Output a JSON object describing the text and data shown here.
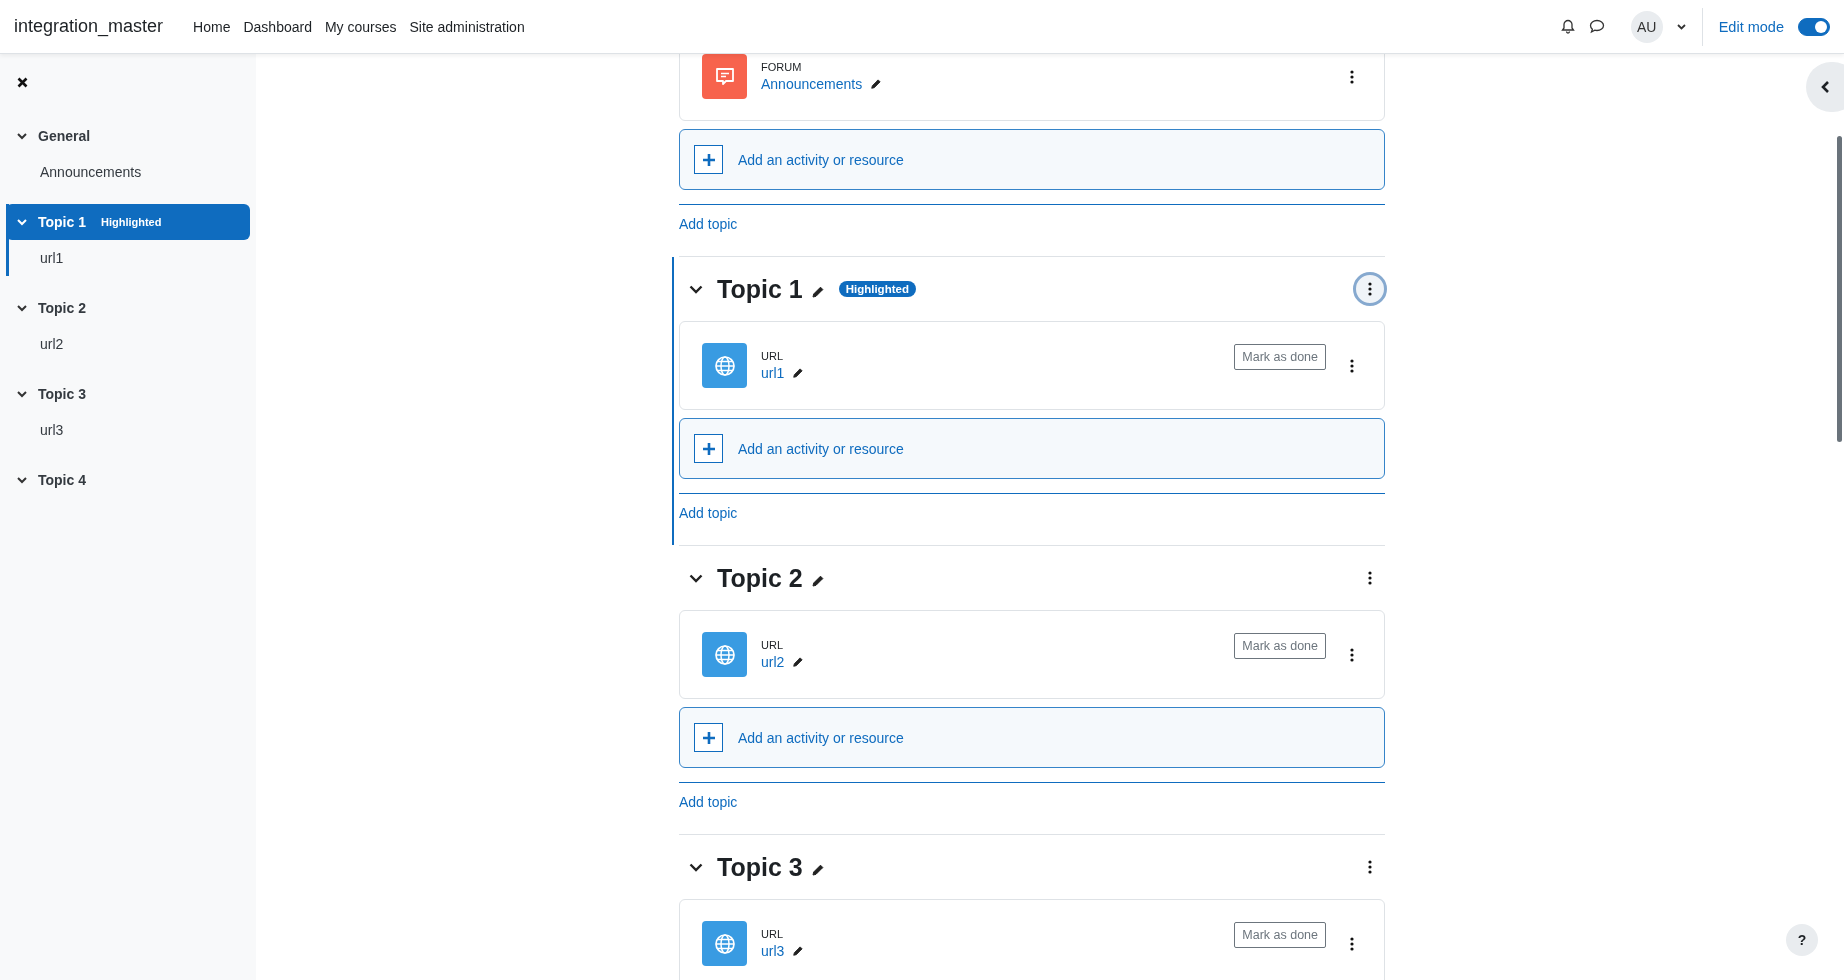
{
  "header": {
    "site_name": "integration_master",
    "nav": [
      {
        "label": "Home"
      },
      {
        "label": "Dashboard"
      },
      {
        "label": "My courses"
      },
      {
        "label": "Site administration"
      }
    ],
    "user_initials": "AU",
    "edit_mode": {
      "label": "Edit mode",
      "on": true
    }
  },
  "course_index": {
    "items": [
      {
        "title": "General",
        "selected": false,
        "children": [
          {
            "title": "Announcements"
          }
        ]
      },
      {
        "title": "Topic 1",
        "badge": "Highlighted",
        "selected": true,
        "children": [
          {
            "title": "url1"
          }
        ]
      },
      {
        "title": "Topic 2",
        "selected": false,
        "children": [
          {
            "title": "url2"
          }
        ]
      },
      {
        "title": "Topic 3",
        "selected": false,
        "children": [
          {
            "title": "url3"
          }
        ]
      },
      {
        "title": "Topic 4",
        "selected": false
      }
    ]
  },
  "sections": [
    {
      "kind": "general",
      "activities": [
        {
          "kind": "forum",
          "type_label": "FORUM",
          "name": "Announcements"
        }
      ],
      "add_activity": "Add an activity or resource",
      "add_topic": "Add topic"
    },
    {
      "kind": "topic",
      "title": "Topic 1",
      "badge": "Highlighted",
      "highlighted": true,
      "menu_focused": true,
      "activities": [
        {
          "kind": "url",
          "type_label": "URL",
          "name": "url1",
          "completion_label": "Mark as done"
        }
      ],
      "add_activity": "Add an activity or resource",
      "add_topic": "Add topic"
    },
    {
      "kind": "topic",
      "title": "Topic 2",
      "highlighted": false,
      "menu_focused": false,
      "activities": [
        {
          "kind": "url",
          "type_label": "URL",
          "name": "url2",
          "completion_label": "Mark as done"
        }
      ],
      "add_activity": "Add an activity or resource",
      "add_topic": "Add topic"
    },
    {
      "kind": "topic",
      "title": "Topic 3",
      "highlighted": false,
      "menu_focused": false,
      "activities": [
        {
          "kind": "url",
          "type_label": "URL",
          "name": "url3",
          "completion_label": "Mark as done"
        }
      ]
    }
  ],
  "help_button": "?"
}
